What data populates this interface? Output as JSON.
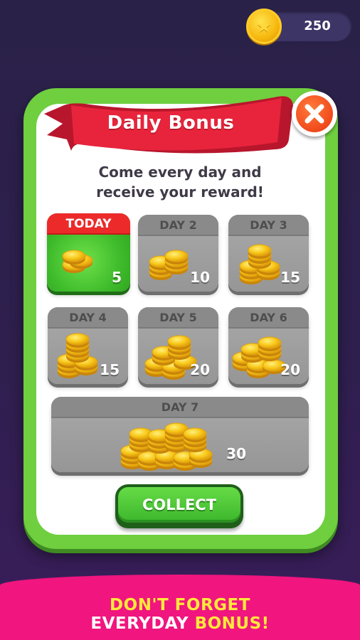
{
  "coin_counter": {
    "value": "250",
    "icon": "coin-star-icon"
  },
  "dialog": {
    "title": "Daily Bonus",
    "subtitle_line1": "Come every day and",
    "subtitle_line2": "receive your reward!",
    "close_icon": "close-x-icon"
  },
  "days": [
    {
      "label": "TODAY",
      "amount": "5",
      "state": "today"
    },
    {
      "label": "DAY 2",
      "amount": "10",
      "state": "locked"
    },
    {
      "label": "DAY 3",
      "amount": "15",
      "state": "locked"
    },
    {
      "label": "DAY 4",
      "amount": "15",
      "state": "locked"
    },
    {
      "label": "DAY 5",
      "amount": "20",
      "state": "locked"
    },
    {
      "label": "DAY 6",
      "amount": "20",
      "state": "locked"
    },
    {
      "label": "DAY 7",
      "amount": "30",
      "state": "locked"
    }
  ],
  "collect_button": {
    "label": "COLLECT"
  },
  "footer": {
    "line1": "DON'T FORGET",
    "line2_prefix": "EVERYDAY ",
    "line2_highlight": "BONUS!"
  },
  "colors": {
    "background": "#2e1f4e",
    "panel_border": "#6fcf3f",
    "ribbon": "#e8243c",
    "today_header": "#ec2a2a",
    "collect_button": "#3cb52c",
    "footer": "#f0157f",
    "footer_highlight": "#ffe93a"
  }
}
